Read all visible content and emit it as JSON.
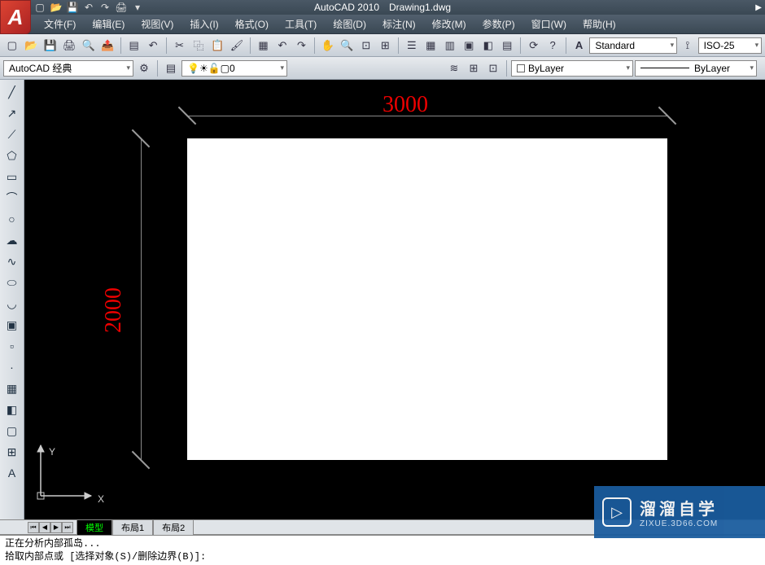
{
  "title": {
    "app": "AutoCAD 2010",
    "doc": "Drawing1.dwg"
  },
  "menu": [
    "文件(F)",
    "编辑(E)",
    "视图(V)",
    "插入(I)",
    "格式(O)",
    "工具(T)",
    "绘图(D)",
    "标注(N)",
    "修改(M)",
    "参数(P)",
    "窗口(W)",
    "帮助(H)"
  ],
  "toolbar1_combos": {
    "text_style": "Standard",
    "dim_style": "ISO-25"
  },
  "toolbar2": {
    "workspace": "AutoCAD 经典",
    "layer": "0",
    "bylayer_color": "ByLayer",
    "bylayer_line": "ByLayer"
  },
  "drawing": {
    "dim_h": "3000",
    "dim_v": "2000",
    "ucs_x": "X",
    "ucs_y": "Y"
  },
  "layout_tabs": [
    "模型",
    "布局1",
    "布局2"
  ],
  "cmd": {
    "line1": "正在分析内部孤岛...",
    "line2": "拾取内部点或 [选择对象(S)/删除边界(B)]:"
  },
  "watermark": {
    "main": "溜溜自学",
    "sub": "ZIXUE.3D66.COM"
  }
}
